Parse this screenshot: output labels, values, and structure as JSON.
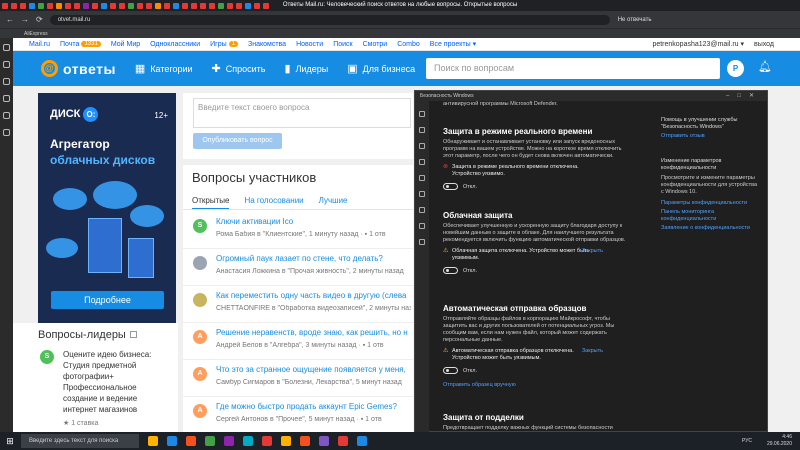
{
  "browser": {
    "page_title": "Ответы Mail.ru: Человеческий поиск ответов на любые вопросы. Открытые вопросы",
    "url": "otvet.mail.ru",
    "bookmark": "AliExpress",
    "translate_label": "Не отвечать",
    "tab_colors": [
      "#e53935",
      "#e53935",
      "#e53935",
      "#1e88e5",
      "#43a047",
      "#e53935",
      "#fb8c00",
      "#e53935",
      "#e53935",
      "#8e24aa",
      "#e53935",
      "#1e88e5",
      "#e53935",
      "#e53935",
      "#43a047",
      "#e53935",
      "#e53935",
      "#fb8c00",
      "#e53935",
      "#1e88e5",
      "#e53935",
      "#e53935",
      "#e53935",
      "#e53935",
      "#43a047",
      "#e53935",
      "#e53935",
      "#1e88e5",
      "#e53935",
      "#e53935"
    ]
  },
  "portal": {
    "links": [
      "Mail.ru",
      "Почта",
      "Мой Мир",
      "Одноклассники",
      "Игры",
      "Знакомства",
      "Новости",
      "Поиск",
      "Смотри",
      "Combo",
      "Все проекты ▾"
    ],
    "mail_count": "1331",
    "games_count": "1",
    "user_email": "petrenkopasha123@mail.ru ▾",
    "logout": "выход"
  },
  "header": {
    "logo_text": "ответы",
    "nav": [
      {
        "icon": "grid-icon",
        "label": "Категории"
      },
      {
        "icon": "plus-icon",
        "label": "Спросить"
      },
      {
        "icon": "bars-icon",
        "label": "Лидеры"
      },
      {
        "icon": "briefcase-icon",
        "label": "Для бизнеса"
      }
    ],
    "search_placeholder": "Поиск по вопросам",
    "avatar_letter": "P"
  },
  "ad": {
    "brand": "ДИСК",
    "brand_logo": "О:",
    "age": "12+",
    "headline_1": "Агрегатор",
    "headline_2": "облачных дисков",
    "button": "Подробнее"
  },
  "leaders": {
    "title": "Вопросы-лидеры",
    "avatar_letter": "S",
    "question": "Оцените идею бизнеса: Студия предметной фотографии+ Профессиональное создание и ведение интернет магазинов",
    "meta": "★ 1 ставка"
  },
  "ask": {
    "placeholder": "Введите текст своего вопроса",
    "button": "Опубликовать вопрос"
  },
  "questions": {
    "title": "Вопросы участников",
    "tabs": [
      "Открытые",
      "На голосовании",
      "Лучшие"
    ],
    "items": [
      {
        "avatar": "S",
        "color": "#4fc05a",
        "title": "Ключи активации Ico",
        "meta": "Рома Бабия в \"Клиентские\", 1 минуту назад  ·  ▪ 1 отв"
      },
      {
        "avatar": "",
        "color": "#9aa5b1",
        "title": "Огромный паук лазает по стене, что делать?",
        "meta": "Анастасия Ложкина в \"Прочая живность\", 2 минуты назад"
      },
      {
        "avatar": "",
        "color": "#c8b560",
        "title": "Как переместить одну часть видео в другую (слева",
        "meta": "CHETTAONFIRE в \"Обработка видеозаписей\", 2 минуты назад"
      },
      {
        "avatar": "A",
        "color": "#ff9e5e",
        "title": "Решение неравенств, вроде знаю, как решить, но н",
        "meta": "Андрей Белов в \"Алгебра\", 3 минуты назад  ·  ▪ 1 отв"
      },
      {
        "avatar": "A",
        "color": "#ff9e5e",
        "title": "Что это за странное ощущение появляется у меня,",
        "meta": "Самбур Сигмаров в \"Болезни, Лекарства\", 5 минут назад"
      },
      {
        "avatar": "A",
        "color": "#ff9e5e",
        "title": "Где можно быстро продать аккаунт Epic Gemes?",
        "meta": "Сергей Антонов в \"Прочее\", 5 минут назад  ·  ▪ 1 отв"
      }
    ]
  },
  "security": {
    "window_title": "Безопасность Windows",
    "top_fragment": "антивирусной программы Microsoft Defender.",
    "sections": [
      {
        "title": "Защита в режиме реального времени",
        "desc": "Обнаруживает и останавливает установку или запуск вредоносных программ на вашем устройстве. Можно на короткое время отключить этот параметр, после чего он будет снова включен автоматически.",
        "warning": "Защита в режиме реального времени отключена. Устройство уязвимо.",
        "warning_link": "",
        "toggle": "Откл."
      },
      {
        "title": "Облачная защита",
        "desc": "Обеспечивает улучшенную и ускоренную защиту благодаря доступу к новейшим данным о защите в облаке. Для наилучшего результата рекомендуется включить функцию автоматической отправки образцов.",
        "warning": "Облачная защита отключена. Устройство может быть уязвимым.",
        "warning_link": "Закрыть",
        "toggle": "Откл."
      },
      {
        "title": "Автоматическая отправка образцов",
        "desc": "Отправляйте образцы файлов в корпорацию Майкрософт, чтобы защитить вас и других пользователей от потенциальных угроз. Мы сообщим вам, если нам нужен файл, который может содержать персональные данные.",
        "warning": "Автоматическая отправка образцов отключена. Устройство может быть уязвимым.",
        "warning_link": "Закрыть",
        "toggle": "Откл.",
        "extra_link": "Отправить образец вручную"
      },
      {
        "title": "Защита от подделки",
        "desc": "Предотвращает подделку важных функций системы безопасности",
        "warning": "",
        "warning_link": "",
        "toggle": ""
      }
    ],
    "right_panel": {
      "help_title": "Помощь в улучшении службы \"Безопасность Windows\"",
      "feedback": "Отправить отзыв",
      "privacy_title": "Изменение параметров конфиденциальности",
      "privacy_desc": "Просмотрите и измените параметры конфиденциальности для устройства с Windows 10.",
      "links": [
        "Параметры конфиденциальности",
        "Панель мониторинга конфиденциальности",
        "Заявление о конфиденциальности"
      ]
    }
  },
  "taskbar": {
    "search": "Введите здесь текст для поиска",
    "lang": "РУС",
    "time": "4:46",
    "date": "29.06.2020",
    "icon_colors": [
      "#ffb300",
      "#1e88e5",
      "#f4511e",
      "#43a047",
      "#8e24aa",
      "#00acc1",
      "#e53935",
      "#ffb300",
      "#f4511e",
      "#7e57c2",
      "#e53935",
      "#1e88e5"
    ]
  }
}
